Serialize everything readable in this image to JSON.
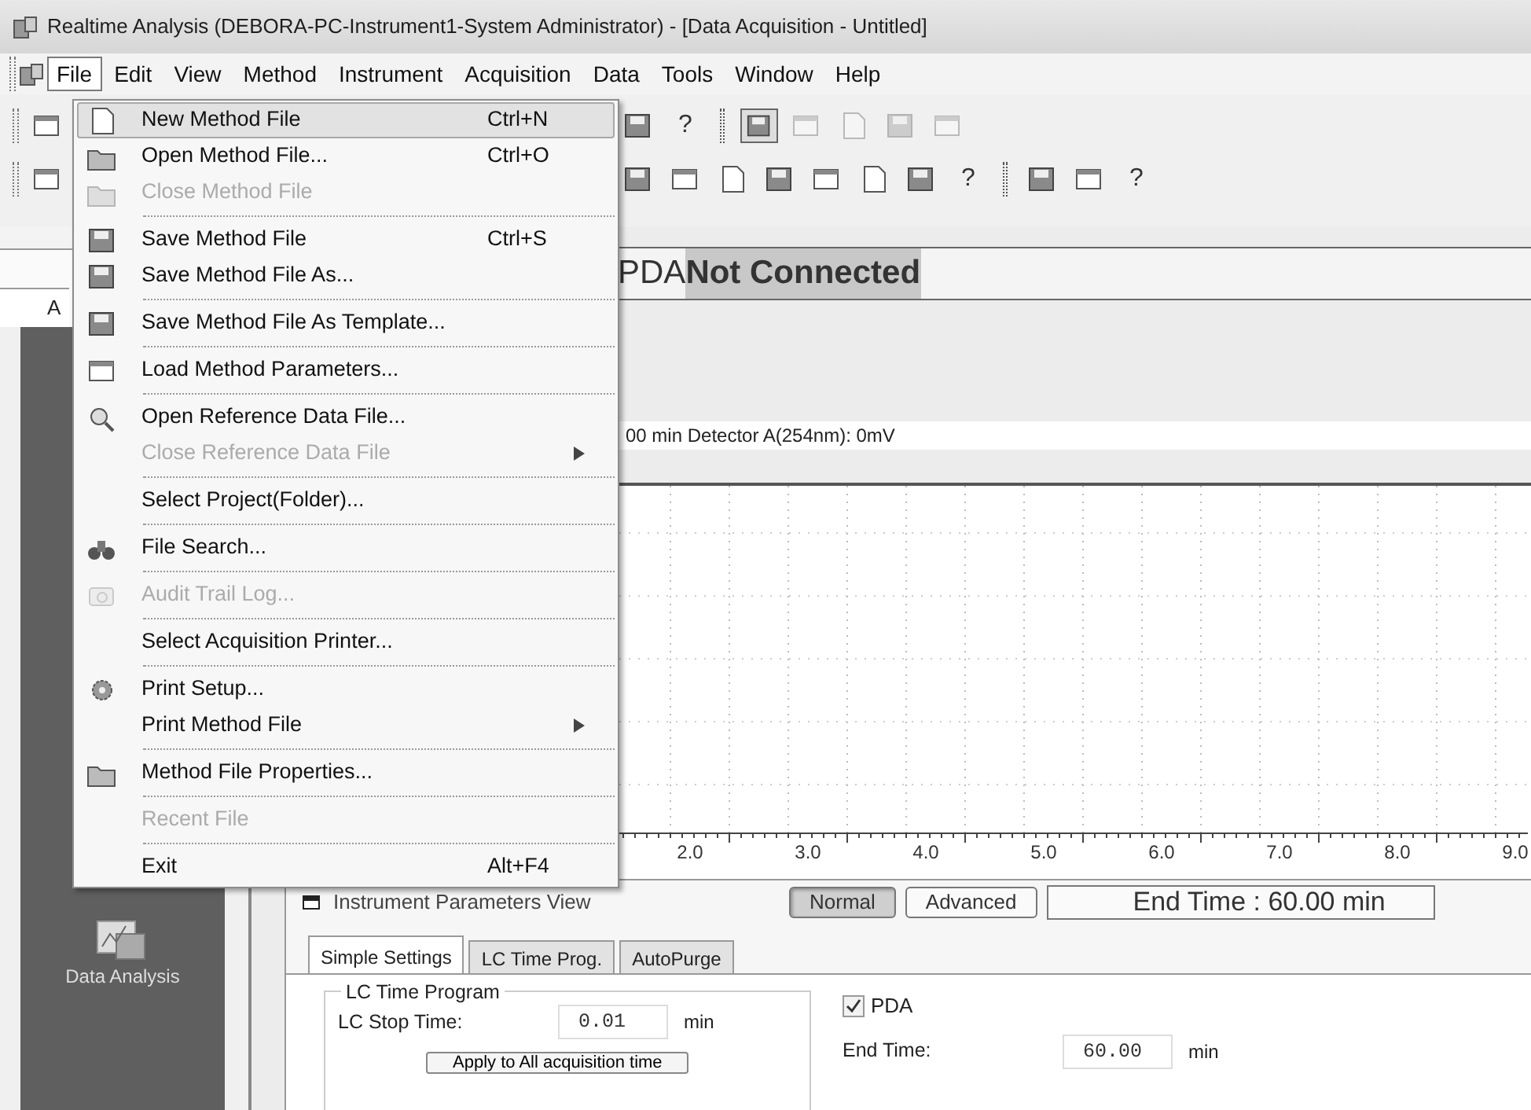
{
  "window": {
    "title": "Realtime Analysis (DEBORA-PC-Instrument1-System Administrator) - [Data Acquisition - Untitled]"
  },
  "menu_bar": [
    {
      "label": "File",
      "selected": true
    },
    {
      "label": "Edit",
      "selected": false
    },
    {
      "label": "View",
      "selected": false
    },
    {
      "label": "Method",
      "selected": false
    },
    {
      "label": "Instrument",
      "selected": false
    },
    {
      "label": "Acquisition",
      "selected": false
    },
    {
      "label": "Data",
      "selected": false
    },
    {
      "label": "Tools",
      "selected": false
    },
    {
      "label": "Window",
      "selected": false
    },
    {
      "label": "Help",
      "selected": false
    }
  ],
  "toolbars": [
    {
      "items": [
        {
          "kind": "button",
          "disabled": false,
          "pressed": false
        },
        {
          "kind": "gap"
        },
        {
          "kind": "button",
          "disabled": false,
          "pressed": false
        },
        {
          "kind": "help",
          "label": "?"
        },
        {
          "kind": "separator"
        },
        {
          "kind": "button",
          "disabled": false,
          "pressed": true
        },
        {
          "kind": "button",
          "disabled": true,
          "pressed": false
        },
        {
          "kind": "button",
          "disabled": true,
          "pressed": false
        },
        {
          "kind": "button",
          "disabled": true,
          "pressed": false
        },
        {
          "kind": "button",
          "disabled": true,
          "pressed": false
        }
      ]
    },
    {
      "items": [
        {
          "kind": "button",
          "disabled": false,
          "pressed": false
        },
        {
          "kind": "gap"
        },
        {
          "kind": "button",
          "disabled": false,
          "pressed": false
        },
        {
          "kind": "button",
          "disabled": false,
          "pressed": false
        },
        {
          "kind": "button",
          "disabled": false,
          "pressed": false
        },
        {
          "kind": "button",
          "disabled": false,
          "pressed": false
        },
        {
          "kind": "button",
          "disabled": false,
          "pressed": false
        },
        {
          "kind": "button",
          "disabled": false,
          "pressed": false
        },
        {
          "kind": "button",
          "disabled": false,
          "pressed": false
        },
        {
          "kind": "help",
          "label": "?"
        },
        {
          "kind": "separator"
        },
        {
          "kind": "button",
          "disabled": false,
          "pressed": false
        },
        {
          "kind": "button",
          "disabled": false,
          "pressed": false
        },
        {
          "kind": "help",
          "label": "?"
        }
      ]
    }
  ],
  "file_menu": [
    {
      "kind": "item",
      "label": "New Method File",
      "shortcut": "Ctrl+N",
      "icon": true,
      "disabled": false,
      "selected": true,
      "submenu": false
    },
    {
      "kind": "item",
      "label": "Open Method File...",
      "shortcut": "Ctrl+O",
      "icon": true,
      "disabled": false,
      "selected": false,
      "submenu": false
    },
    {
      "kind": "item",
      "label": "Close Method File",
      "icon": true,
      "disabled": true,
      "selected": false,
      "submenu": false
    },
    {
      "kind": "separator"
    },
    {
      "kind": "item",
      "label": "Save Method File",
      "shortcut": "Ctrl+S",
      "icon": true,
      "disabled": false,
      "selected": false,
      "submenu": false
    },
    {
      "kind": "item",
      "label": "Save Method File As...",
      "icon": true,
      "disabled": false,
      "selected": false,
      "submenu": false
    },
    {
      "kind": "separator"
    },
    {
      "kind": "item",
      "label": "Save Method File As Template...",
      "icon": true,
      "disabled": false,
      "selected": false,
      "submenu": false
    },
    {
      "kind": "separator"
    },
    {
      "kind": "item",
      "label": "Load Method Parameters...",
      "icon": true,
      "disabled": false,
      "selected": false,
      "submenu": false
    },
    {
      "kind": "separator"
    },
    {
      "kind": "item",
      "label": "Open Reference Data File...",
      "icon": true,
      "disabled": false,
      "selected": false,
      "submenu": false
    },
    {
      "kind": "item",
      "label": "Close Reference Data File",
      "icon": false,
      "disabled": true,
      "selected": false,
      "submenu": true
    },
    {
      "kind": "separator"
    },
    {
      "kind": "item",
      "label": "Select Project(Folder)...",
      "icon": false,
      "disabled": false,
      "selected": false,
      "submenu": false
    },
    {
      "kind": "separator"
    },
    {
      "kind": "item",
      "label": "File Search...",
      "icon": true,
      "disabled": false,
      "selected": false,
      "submenu": false
    },
    {
      "kind": "separator"
    },
    {
      "kind": "item",
      "label": "Audit Trail Log...",
      "icon": true,
      "disabled": true,
      "selected": false,
      "submenu": false
    },
    {
      "kind": "separator"
    },
    {
      "kind": "item",
      "label": "Select Acquisition Printer...",
      "icon": false,
      "disabled": false,
      "selected": false,
      "submenu": false
    },
    {
      "kind": "separator"
    },
    {
      "kind": "item",
      "label": "Print Setup...",
      "icon": true,
      "disabled": false,
      "selected": false,
      "submenu": false
    },
    {
      "kind": "item",
      "label": "Print Method File",
      "icon": false,
      "disabled": false,
      "selected": false,
      "submenu": true
    },
    {
      "kind": "separator"
    },
    {
      "kind": "item",
      "label": "Method File Properties...",
      "icon": true,
      "disabled": false,
      "selected": false,
      "submenu": false
    },
    {
      "kind": "separator"
    },
    {
      "kind": "item",
      "label": "Recent File",
      "icon": false,
      "disabled": true,
      "selected": false,
      "submenu": false
    },
    {
      "kind": "separator"
    },
    {
      "kind": "item",
      "label": "Exit",
      "shortcut": "Alt+F4",
      "icon": false,
      "disabled": false,
      "selected": false,
      "submenu": false
    }
  ],
  "sidebar": {
    "tab": "A",
    "items": [
      {
        "label": "Data Analysis"
      }
    ]
  },
  "status": {
    "device": "PDA",
    "state": "Not Connected"
  },
  "detector_readout": "00 min Detector A(254nm): 0mV",
  "chart": {
    "x_tick_labels": [
      "2.0",
      "3.0",
      "4.0",
      "5.0",
      "6.0",
      "7.0",
      "8.0",
      "9.0"
    ]
  },
  "instrument_panel": {
    "title": "Instrument Parameters View",
    "modes": [
      {
        "label": "Normal",
        "selected": true
      },
      {
        "label": "Advanced",
        "selected": false
      }
    ],
    "end_time": "End Time : 60.00 min",
    "tabs": [
      {
        "label": "Simple Settings",
        "selected": true
      },
      {
        "label": "LC Time Prog.",
        "selected": false
      },
      {
        "label": "AutoPurge",
        "selected": false
      }
    ],
    "lc_group": {
      "title": "LC Time Program",
      "stop_time_label": "LC Stop Time:",
      "stop_time": "0.01",
      "unit": "min",
      "apply_button": "Apply to All acquisition time"
    },
    "pda": {
      "label": "PDA",
      "checked": true,
      "end_time_label": "End Time:",
      "end_time": "60.00",
      "unit": "min"
    }
  }
}
